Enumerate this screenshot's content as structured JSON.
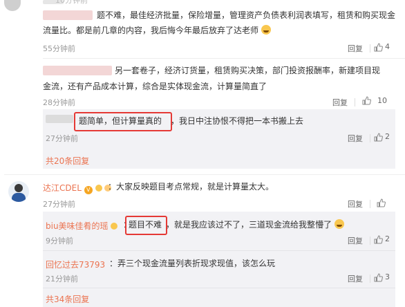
{
  "comments": [
    {
      "text_line1": "题不难，最佳经济批量，保险增量，管理资产负债表利润表填写，租赁和购买现金",
      "text_line2": "流量比。都是前几章的内容，我后悔今年最后放弃了达老师",
      "top_time": "10分钟前",
      "time": "55分钟前",
      "reply_label": "回复",
      "like_count": "4"
    },
    {
      "text_line1": "另一套卷子，经济订货量，租赁购买决策，部门投资报酬率，新建项目现",
      "text_line2": "金流，还有产品成本计算，综合是实体现金流，计算量简直了",
      "time": "28分钟前",
      "reply_label": "回复",
      "like_count": "10",
      "sub": {
        "highlight": "题简单，但计算量真的",
        "rest": "，我日中注协恨不得把一本书搬上去",
        "time": "27分钟前",
        "reply_label": "回复",
        "like_count": "2"
      },
      "more_replies": "共20条回复"
    },
    {
      "author": "达江CDEL",
      "text": "：大家反映题目考点常规，就是计算量太大。",
      "time": "27分钟前",
      "reply_label": "回复",
      "like_count": "",
      "sub1": {
        "author": "biu美味佳肴的瑶",
        "sep": "：",
        "highlight": "题目不难",
        "rest": "，就是我应该过不了，三道现金流给我整懵了",
        "time": "9分钟前",
        "reply_label": "回复",
        "like_count": "2"
      },
      "sub2": {
        "author": "回忆过去73793",
        "text": "：弄三个现金流量列表折现求现值，该怎么玩",
        "time": "21分钟前",
        "reply_label": "回复",
        "like_count": "3"
      },
      "more_replies": "共34条回复"
    }
  ]
}
